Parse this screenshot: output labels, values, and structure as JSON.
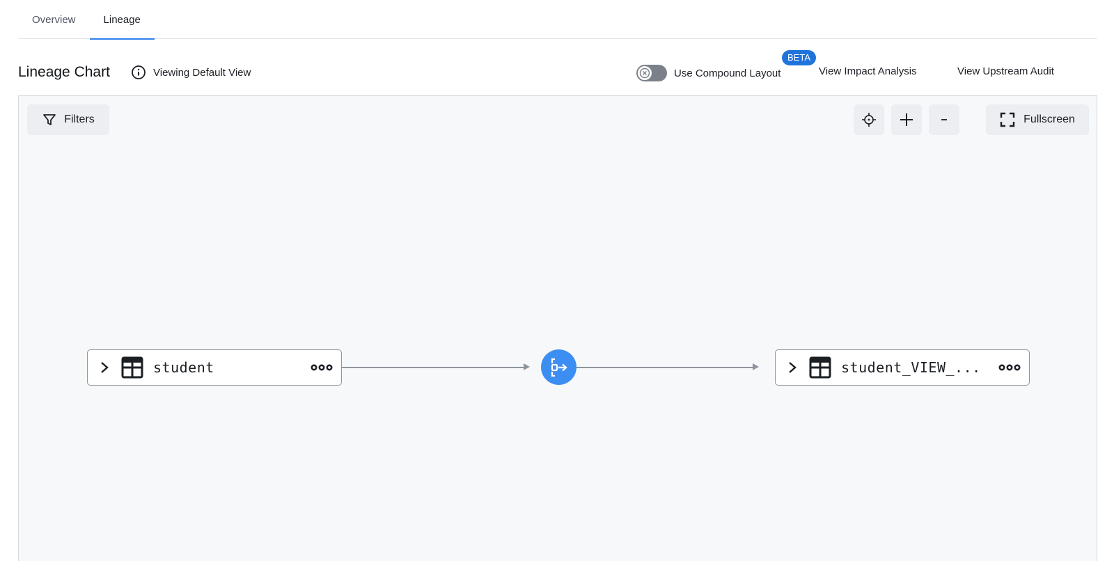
{
  "tabs": [
    {
      "label": "Overview",
      "active": false
    },
    {
      "label": "Lineage",
      "active": true
    }
  ],
  "header": {
    "title": "Lineage Chart",
    "view_label": "Viewing Default View",
    "compound_label": "Use Compound Layout",
    "compound_enabled": false,
    "beta_badge": "BETA",
    "impact_link": "View Impact Analysis",
    "upstream_link": "View Upstream Audit"
  },
  "canvas": {
    "filters_label": "Filters",
    "fullscreen_label": "Fullscreen",
    "controls": [
      "fit-view-icon",
      "zoom-in-icon",
      "zoom-out-icon"
    ]
  },
  "nodes": [
    {
      "name": "student",
      "type": "table"
    },
    {
      "name": "student_VIEW_...",
      "type": "table"
    }
  ],
  "process_node": {
    "icon": "process-icon"
  },
  "colors": {
    "accent": "#2f80ed",
    "process": "#3d8ef2",
    "beta": "#1f74db",
    "canvas_bg": "#f7f8fa"
  }
}
